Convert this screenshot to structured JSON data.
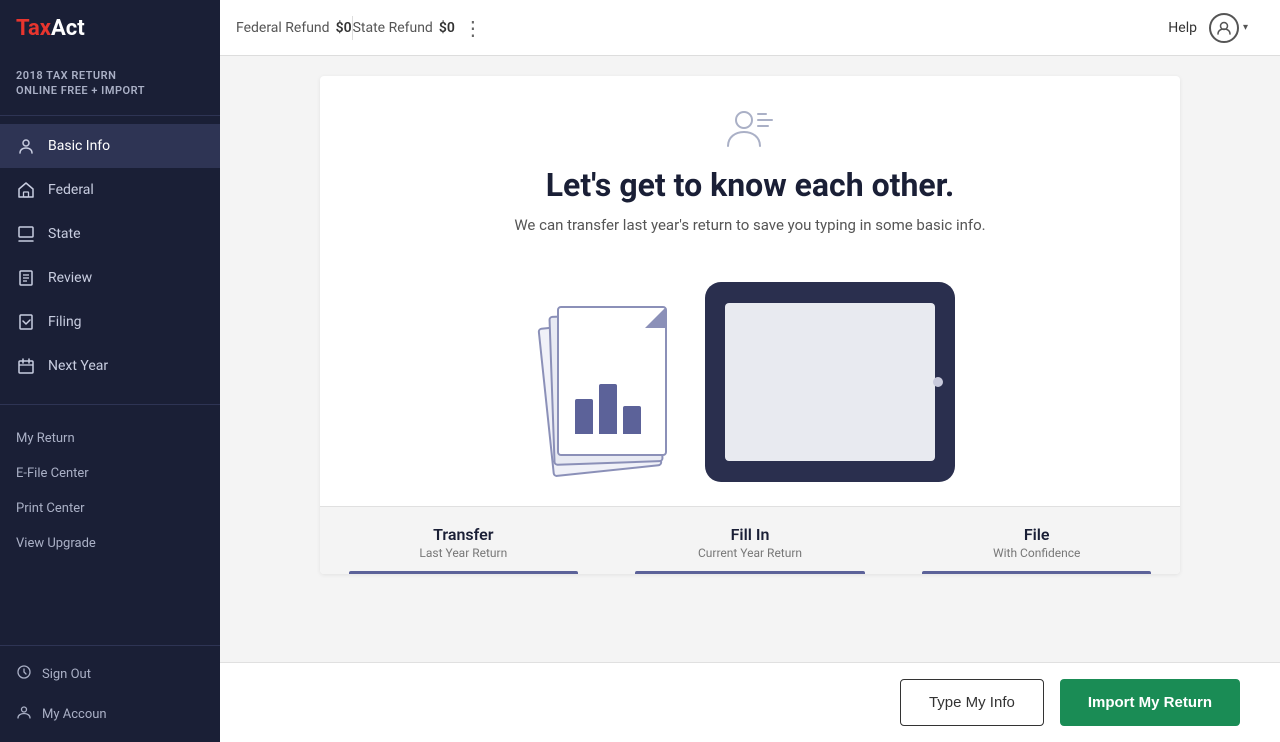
{
  "app": {
    "logo_tax": "Tax",
    "logo_act": "Act",
    "subtitle1": "2018 TAX RETURN",
    "subtitle2": "ONLINE FREE + IMPORT"
  },
  "topbar": {
    "federal_refund_label": "Federal Refund",
    "federal_refund_amount": "$0",
    "state_refund_label": "State Refund",
    "state_refund_amount": "$0",
    "help_label": "Help"
  },
  "sidebar": {
    "nav_items": [
      {
        "id": "basic-info",
        "label": "Basic Info",
        "active": true
      },
      {
        "id": "federal",
        "label": "Federal",
        "active": false
      },
      {
        "id": "state",
        "label": "State",
        "active": false
      },
      {
        "id": "review",
        "label": "Review",
        "active": false
      },
      {
        "id": "filing",
        "label": "Filing",
        "active": false
      },
      {
        "id": "next-year",
        "label": "Next Year",
        "active": false
      }
    ],
    "secondary_items": [
      {
        "id": "my-return",
        "label": "My Return"
      },
      {
        "id": "efile-center",
        "label": "E-File Center"
      },
      {
        "id": "print-center",
        "label": "Print Center"
      },
      {
        "id": "view-upgrade",
        "label": "View Upgrade"
      }
    ],
    "bottom_items": [
      {
        "id": "sign-out",
        "label": "Sign Out"
      },
      {
        "id": "my-account",
        "label": "My Accoun"
      }
    ]
  },
  "main": {
    "heading": "Let's get to know each other.",
    "subheading": "We can transfer last year's return to save you typing in some basic info.",
    "steps": [
      {
        "title": "Transfer",
        "subtitle": "Last Year Return"
      },
      {
        "title": "Fill In",
        "subtitle": "Current Year Return"
      },
      {
        "title": "File",
        "subtitle": "With Confidence"
      }
    ]
  },
  "footer": {
    "type_my_info_label": "Type My Info",
    "import_my_return_label": "Import My Return"
  }
}
